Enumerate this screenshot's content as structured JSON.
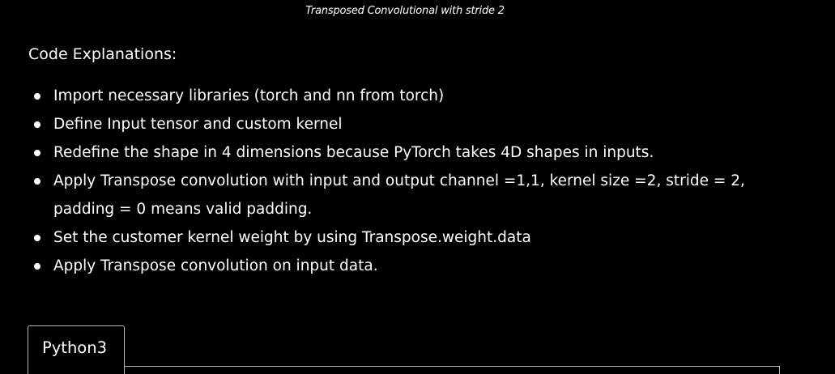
{
  "caption": "Transposed Convolutional  with stride 2",
  "heading": "Code Explanations:",
  "bullets": [
    "Import necessary libraries (torch and nn from torch)",
    "Define Input tensor and custom kernel",
    "Redefine the shape in 4 dimensions because PyTorch takes 4D shapes in inputs.",
    "Apply Transpose convolution with input and output channel =1,1, kernel size =2, stride = 2, padding = 0 means valid padding.",
    "Set the customer kernel weight by using Transpose.weight.data",
    "Apply Transpose convolution on input data."
  ],
  "code_tab": {
    "label": "Python3"
  }
}
